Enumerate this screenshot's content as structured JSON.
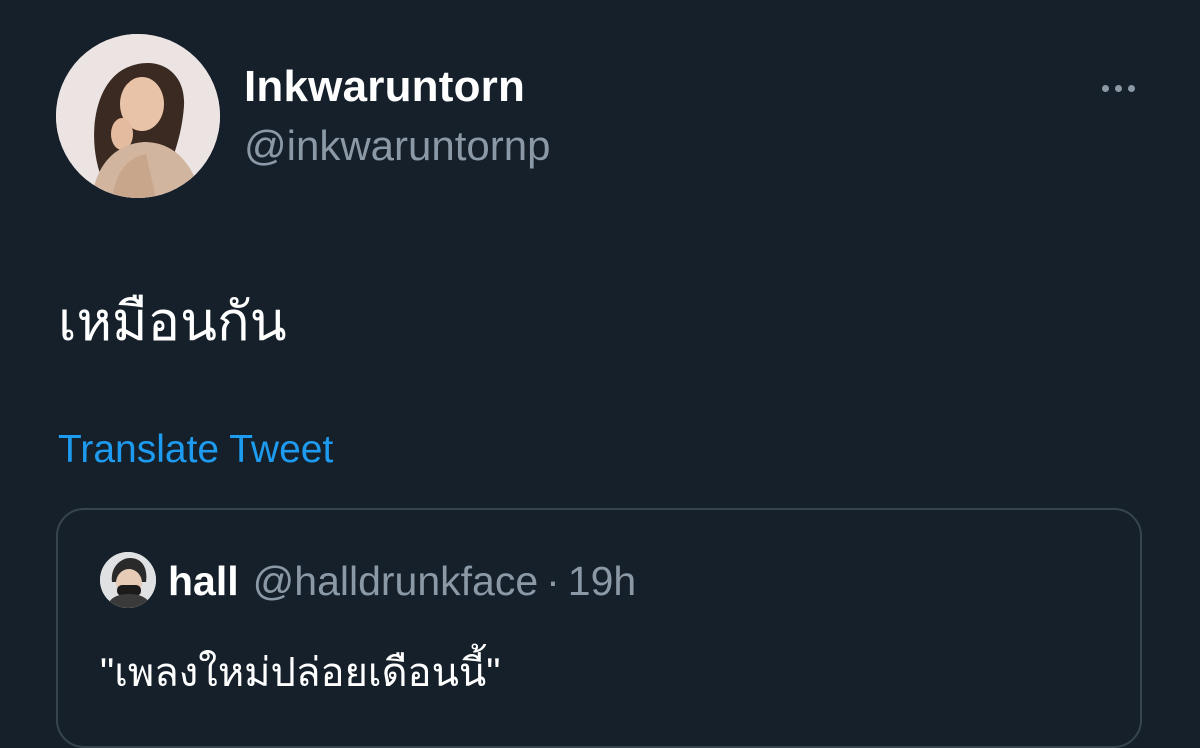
{
  "tweet": {
    "display_name": "Inkwaruntorn",
    "handle": "@inkwaruntornp",
    "text": "เหมือนกัน",
    "translate_label": "Translate Tweet",
    "more_icon": "more-horizontal-icon"
  },
  "quote": {
    "name": "hall",
    "handle": "@halldrunkface",
    "separator": "·",
    "time": "19h",
    "text": "\"เพลงใหม่ปล่อยเดือนนี้\""
  },
  "colors": {
    "background": "#15202b",
    "primary_text": "#ffffff",
    "secondary_text": "#8b98a5",
    "link": "#1d9bf0",
    "border": "#38444d"
  }
}
